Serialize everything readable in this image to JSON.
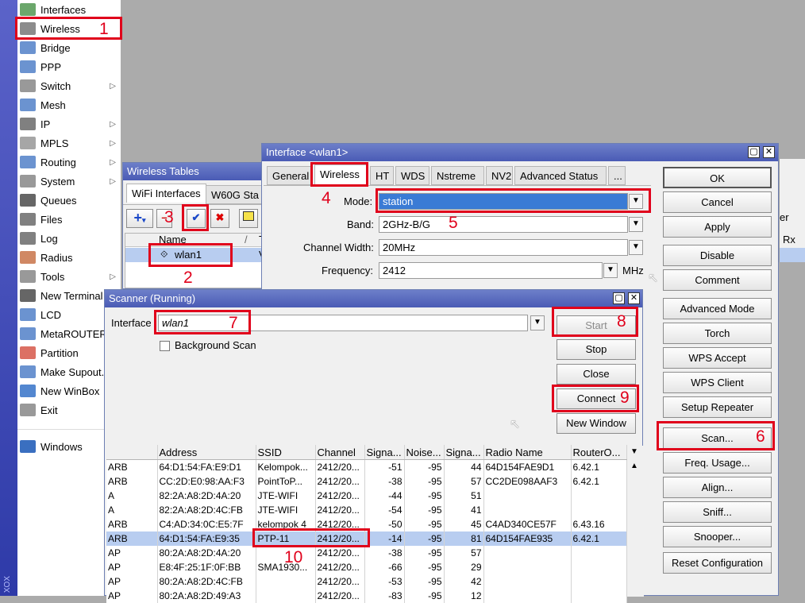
{
  "sidebar": {
    "vertical_text": "XOX",
    "items": [
      {
        "label": "Interfaces",
        "icon": "interfaces-icon",
        "arrow": false
      },
      {
        "label": "Wireless",
        "icon": "wireless-icon",
        "arrow": false
      },
      {
        "label": "Bridge",
        "icon": "bridge-icon",
        "arrow": false
      },
      {
        "label": "PPP",
        "icon": "ppp-icon",
        "arrow": false
      },
      {
        "label": "Switch",
        "icon": "switch-icon",
        "arrow": true
      },
      {
        "label": "Mesh",
        "icon": "mesh-icon",
        "arrow": false
      },
      {
        "label": "IP",
        "icon": "ip-icon",
        "arrow": true
      },
      {
        "label": "MPLS",
        "icon": "mpls-icon",
        "arrow": true
      },
      {
        "label": "Routing",
        "icon": "routing-icon",
        "arrow": true
      },
      {
        "label": "System",
        "icon": "system-icon",
        "arrow": true
      },
      {
        "label": "Queues",
        "icon": "queues-icon",
        "arrow": false
      },
      {
        "label": "Files",
        "icon": "files-icon",
        "arrow": false
      },
      {
        "label": "Log",
        "icon": "log-icon",
        "arrow": false
      },
      {
        "label": "Radius",
        "icon": "radius-icon",
        "arrow": false
      },
      {
        "label": "Tools",
        "icon": "tools-icon",
        "arrow": true
      },
      {
        "label": "New Terminal",
        "icon": "terminal-icon",
        "arrow": false
      },
      {
        "label": "LCD",
        "icon": "lcd-icon",
        "arrow": false
      },
      {
        "label": "MetaROUTER",
        "icon": "metarouter-icon",
        "arrow": false
      },
      {
        "label": "Partition",
        "icon": "partition-icon",
        "arrow": false
      },
      {
        "label": "Make Supout.rif",
        "icon": "supout-icon",
        "arrow": false
      },
      {
        "label": "New WinBox",
        "icon": "winbox-icon",
        "arrow": false
      },
      {
        "label": "Exit",
        "icon": "exit-icon",
        "arrow": false
      }
    ],
    "windows_label": "Windows"
  },
  "annotations": [
    "1",
    "2",
    "3",
    "4",
    "5",
    "6",
    "7",
    "8",
    "9",
    "10"
  ],
  "wireless_tables": {
    "title": "Wireless Tables",
    "tabs": [
      "WiFi Interfaces",
      "W60G Sta"
    ],
    "column_name": "Name",
    "column_sort": "/",
    "column_type": "T",
    "row_name": "wlan1",
    "row_type": "V"
  },
  "interface_window": {
    "title": "Interface <wlan1>",
    "tabs": [
      "General",
      "Wireless",
      "HT",
      "WDS",
      "Nstreme",
      "NV2",
      "Advanced Status",
      "..."
    ],
    "mode_label": "Mode:",
    "mode_value": "station",
    "band_label": "Band:",
    "band_value": "2GHz-B/G",
    "channel_width_label": "Channel Width:",
    "channel_width_value": "20MHz",
    "frequency_label": "Frequency:",
    "frequency_value": "2412",
    "frequency_unit": "MHz",
    "buttons": [
      "OK",
      "Cancel",
      "Apply",
      "Disable",
      "Comment",
      "Advanced Mode",
      "Torch",
      "WPS Accept",
      "WPS Client",
      "Setup Repeater",
      "Scan...",
      "Freq. Usage...",
      "Align...",
      "Sniff...",
      "Snooper...",
      "Reset Configuration"
    ],
    "right_peek_label": "er",
    "right_peek_header": "Rx Pc"
  },
  "scanner": {
    "title": "Scanner (Running)",
    "interface_label": "Interface",
    "interface_value": "wlan1",
    "background_scan_label": "Background Scan",
    "buttons": {
      "start": "Start",
      "stop": "Stop",
      "close": "Close",
      "connect": "Connect",
      "new_window": "New Window"
    },
    "columns": [
      "",
      "Address",
      "SSID",
      "Channel",
      "Signa...",
      "Noise...",
      "Signa...",
      "Radio Name",
      "RouterO..."
    ],
    "rows": [
      [
        "ARB",
        "64:D1:54:FA:E9:D1",
        "Kelompok...",
        "2412/20...",
        "-51",
        "-95",
        "44",
        "64D154FAE9D1",
        "6.42.1"
      ],
      [
        "ARB",
        "CC:2D:E0:98:AA:F3",
        "PointToP...",
        "2412/20...",
        "-38",
        "-95",
        "57",
        "CC2DE098AAF3",
        "6.42.1"
      ],
      [
        "A",
        "82:2A:A8:2D:4A:20",
        "JTE-WIFI",
        "2412/20...",
        "-44",
        "-95",
        "51",
        "",
        ""
      ],
      [
        "A",
        "82:2A:A8:2D:4C:FB",
        "JTE-WIFI",
        "2412/20...",
        "-54",
        "-95",
        "41",
        "",
        ""
      ],
      [
        "ARB",
        "C4:AD:34:0C:E5:7F",
        "kelompok 4",
        "2412/20...",
        "-50",
        "-95",
        "45",
        "C4AD340CE57F",
        "6.43.16"
      ],
      [
        "ARB",
        "64:D1:54:FA:E9:35",
        "PTP-11",
        "2412/20...",
        "-14",
        "-95",
        "81",
        "64D154FAE935",
        "6.42.1"
      ],
      [
        "AP",
        "80:2A:A8:2D:4A:20",
        "",
        "2412/20...",
        "-38",
        "-95",
        "57",
        "",
        ""
      ],
      [
        "AP",
        "E8:4F:25:1F:0F:BB",
        "SMA1930...",
        "2412/20...",
        "-66",
        "-95",
        "29",
        "",
        ""
      ],
      [
        "AP",
        "80:2A:A8:2D:4C:FB",
        "",
        "2412/20...",
        "-53",
        "-95",
        "42",
        "",
        ""
      ],
      [
        "AP",
        "80:2A:A8:2D:49:A3",
        "",
        "2412/20...",
        "-83",
        "-95",
        "12",
        "",
        ""
      ]
    ],
    "selected_row": 5
  },
  "colors": {
    "annotation_red": "#e0001b",
    "titlebar": "#5566c0",
    "selection": "#b8cdf0",
    "mode_highlight": "#3a7bd5"
  }
}
